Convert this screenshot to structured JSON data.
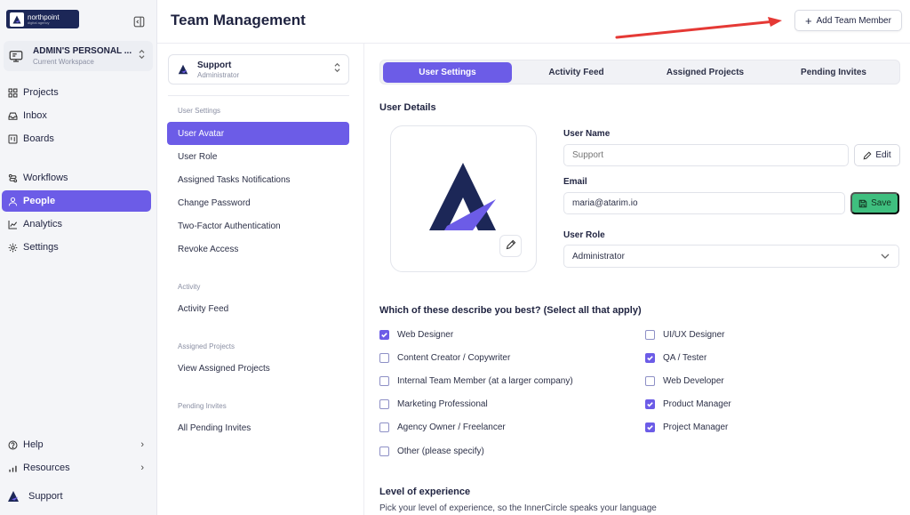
{
  "sidebar": {
    "logo_text": "northpoint",
    "logo_sub": "digital agency",
    "workspace_name": "ADMIN'S PERSONAL ...",
    "workspace_sub": "Current Workspace",
    "nav": [
      {
        "label": "Projects",
        "icon": "grid-icon"
      },
      {
        "label": "Inbox",
        "icon": "inbox-icon"
      },
      {
        "label": "Boards",
        "icon": "board-icon"
      },
      {
        "label": "Workflows",
        "icon": "workflow-icon"
      },
      {
        "label": "People",
        "icon": "user-icon",
        "active": true
      },
      {
        "label": "Analytics",
        "icon": "analytics-icon"
      },
      {
        "label": "Settings",
        "icon": "gear-icon"
      }
    ],
    "help_label": "Help",
    "resources_label": "Resources",
    "footer_user": "Support"
  },
  "header": {
    "title": "Team Management",
    "add_member_label": "Add Team Member"
  },
  "settings_nav": {
    "user_name": "Support",
    "user_role": "Administrator",
    "groups": {
      "user_settings": "User Settings",
      "activity": "Activity",
      "assigned_projects": "Assigned Projects",
      "pending_invites": "Pending Invites"
    },
    "items": {
      "user_avatar": "User Avatar",
      "user_role": "User Role",
      "assigned_tasks": "Assigned Tasks Notifications",
      "change_password": "Change Password",
      "two_factor": "Two-Factor Authentication",
      "revoke": "Revoke Access",
      "activity_feed": "Activity Feed",
      "view_projects": "View Assigned Projects",
      "all_invites": "All Pending Invites"
    }
  },
  "tabs": [
    "User Settings",
    "Activity Feed",
    "Assigned Projects",
    "Pending Invites"
  ],
  "user_details": {
    "title": "User Details",
    "name_label": "User Name",
    "name_placeholder": "Support",
    "edit_label": "Edit",
    "email_label": "Email",
    "email_value": "maria@atarim.io",
    "save_label": "Save",
    "role_label": "User Role",
    "role_value": "Administrator"
  },
  "question": {
    "title": "Which of these describe you best? (Select all that apply)",
    "left": [
      {
        "label": "Web Designer",
        "checked": true
      },
      {
        "label": "Content Creator / Copywriter",
        "checked": false
      },
      {
        "label": "Internal Team Member (at a larger company)",
        "checked": false
      },
      {
        "label": "Marketing Professional",
        "checked": false
      },
      {
        "label": "Agency Owner / Freelancer",
        "checked": false
      },
      {
        "label": "Other (please specify)",
        "checked": false
      }
    ],
    "right": [
      {
        "label": "UI/UX Designer",
        "checked": false
      },
      {
        "label": "QA / Tester",
        "checked": true
      },
      {
        "label": "Web Developer",
        "checked": false
      },
      {
        "label": "Product Manager",
        "checked": true
      },
      {
        "label": "Project Manager",
        "checked": true
      }
    ]
  },
  "experience": {
    "title": "Level of experience",
    "subtitle": "Pick your level of experience, so the InnerCircle speaks your language"
  },
  "colors": {
    "accent": "#6c5ce7",
    "save": "#3fbf7f",
    "arrow": "#e53935",
    "logo_bg": "#1c2757"
  }
}
